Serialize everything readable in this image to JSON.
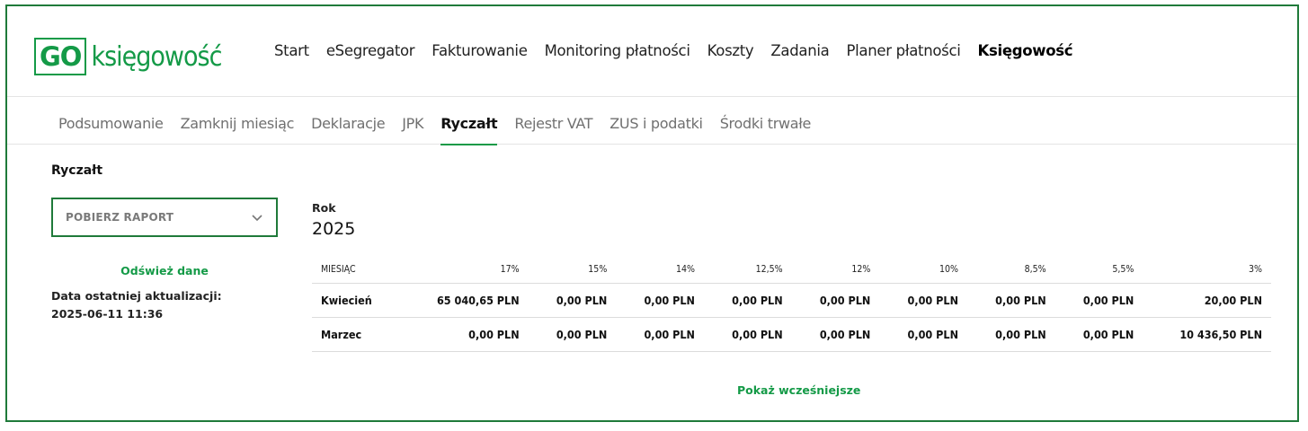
{
  "logo": {
    "box_text": "GO",
    "text": "księgowość"
  },
  "main_nav": [
    {
      "label": "Start",
      "active": false
    },
    {
      "label": "eSegregator",
      "active": false
    },
    {
      "label": "Fakturowanie",
      "active": false
    },
    {
      "label": "Monitoring płatności",
      "active": false
    },
    {
      "label": "Koszty",
      "active": false
    },
    {
      "label": "Zadania",
      "active": false
    },
    {
      "label": "Planer płatności",
      "active": false
    },
    {
      "label": "Księgowość",
      "active": true
    }
  ],
  "sub_nav": [
    {
      "label": "Podsumowanie",
      "active": false
    },
    {
      "label": "Zamknij miesiąc",
      "active": false
    },
    {
      "label": "Deklaracje",
      "active": false
    },
    {
      "label": "JPK",
      "active": false
    },
    {
      "label": "Ryczałt",
      "active": true
    },
    {
      "label": "Rejestr VAT",
      "active": false
    },
    {
      "label": "ZUS i podatki",
      "active": false
    },
    {
      "label": "Środki trwałe",
      "active": false
    }
  ],
  "left_panel": {
    "title": "Ryczałt",
    "report_dropdown": "POBIERZ RAPORT",
    "refresh_link": "Odśwież dane",
    "updated_label": "Data ostatniej aktualizacji:",
    "updated_value": "2025-06-11 11:36"
  },
  "year": {
    "label": "Rok",
    "value": "2025"
  },
  "table": {
    "headers": [
      "MIESIĄC",
      "17%",
      "15%",
      "14%",
      "12,5%",
      "12%",
      "10%",
      "8,5%",
      "5,5%",
      "3%"
    ],
    "rows": [
      [
        "Kwiecień",
        "65 040,65 PLN",
        "0,00 PLN",
        "0,00 PLN",
        "0,00 PLN",
        "0,00 PLN",
        "0,00 PLN",
        "0,00 PLN",
        "0,00 PLN",
        "20,00 PLN"
      ],
      [
        "Marzec",
        "0,00 PLN",
        "0,00 PLN",
        "0,00 PLN",
        "0,00 PLN",
        "0,00 PLN",
        "0,00 PLN",
        "0,00 PLN",
        "0,00 PLN",
        "10 436,50 PLN"
      ]
    ]
  },
  "show_more": "Pokaż wcześniejsze",
  "colors": {
    "brand_green": "#149a47",
    "frame_green": "#1f7a3a"
  }
}
